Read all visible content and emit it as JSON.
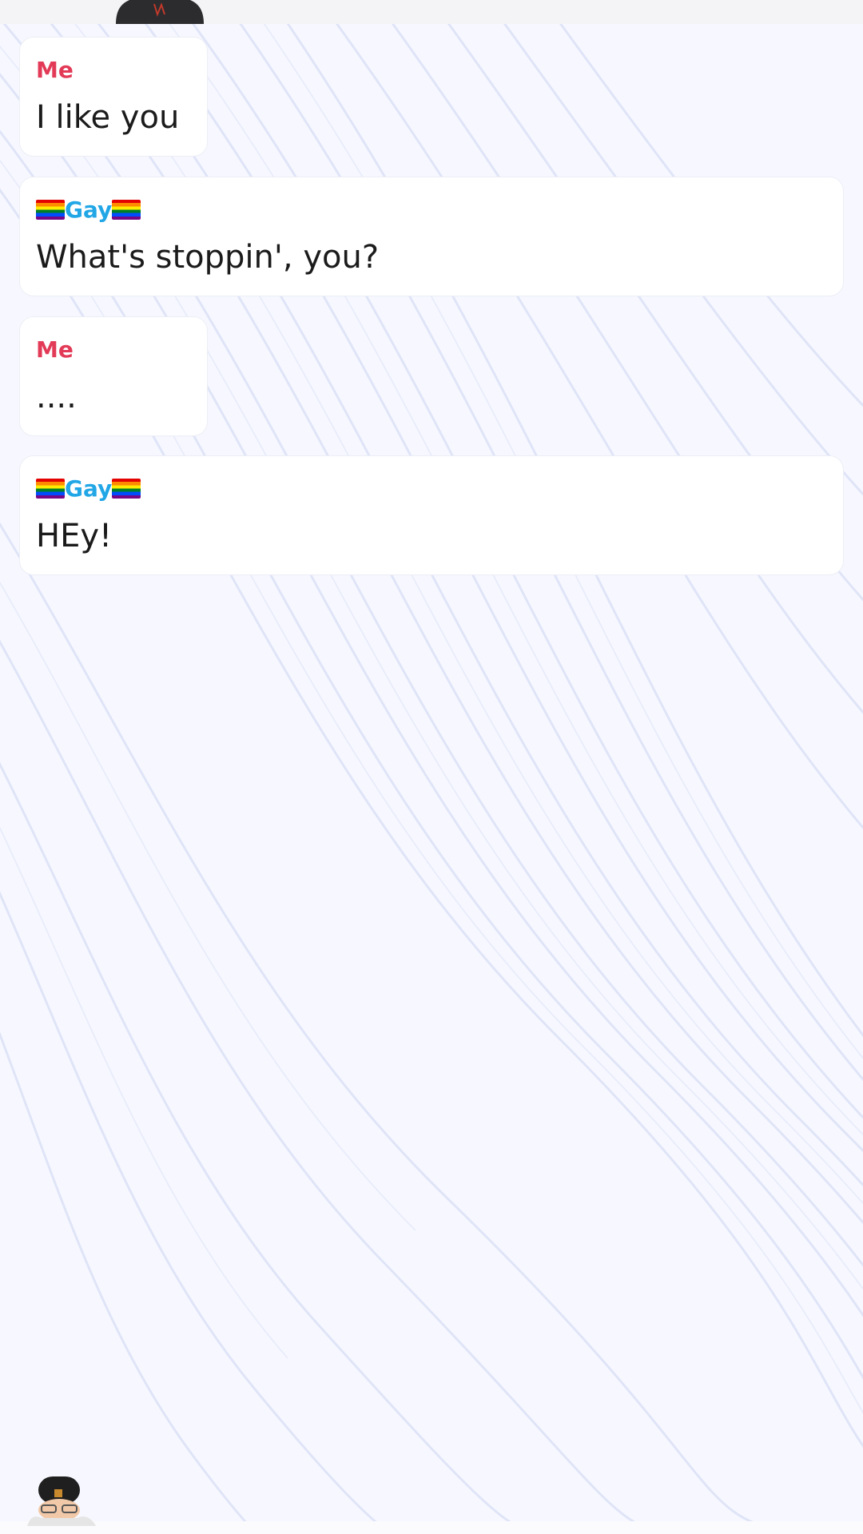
{
  "messages": [
    {
      "sender": "Me",
      "text": "I like you"
    },
    {
      "sender": "Gay",
      "text": "What's stoppin', you?"
    },
    {
      "sender": "Me",
      "text": "...."
    },
    {
      "sender": "Gay",
      "text": "HEy!"
    }
  ],
  "icons": {
    "flag": "rainbow-flag-icon",
    "top_avatar": "bitmoji-avatar-icon",
    "bottom_avatar": "bitmoji-avatar-icon"
  },
  "colors": {
    "me_name": "#e23a57",
    "other_name": "#21a6e6",
    "text": "#1b1b1b",
    "bubble": "#ffffff"
  }
}
